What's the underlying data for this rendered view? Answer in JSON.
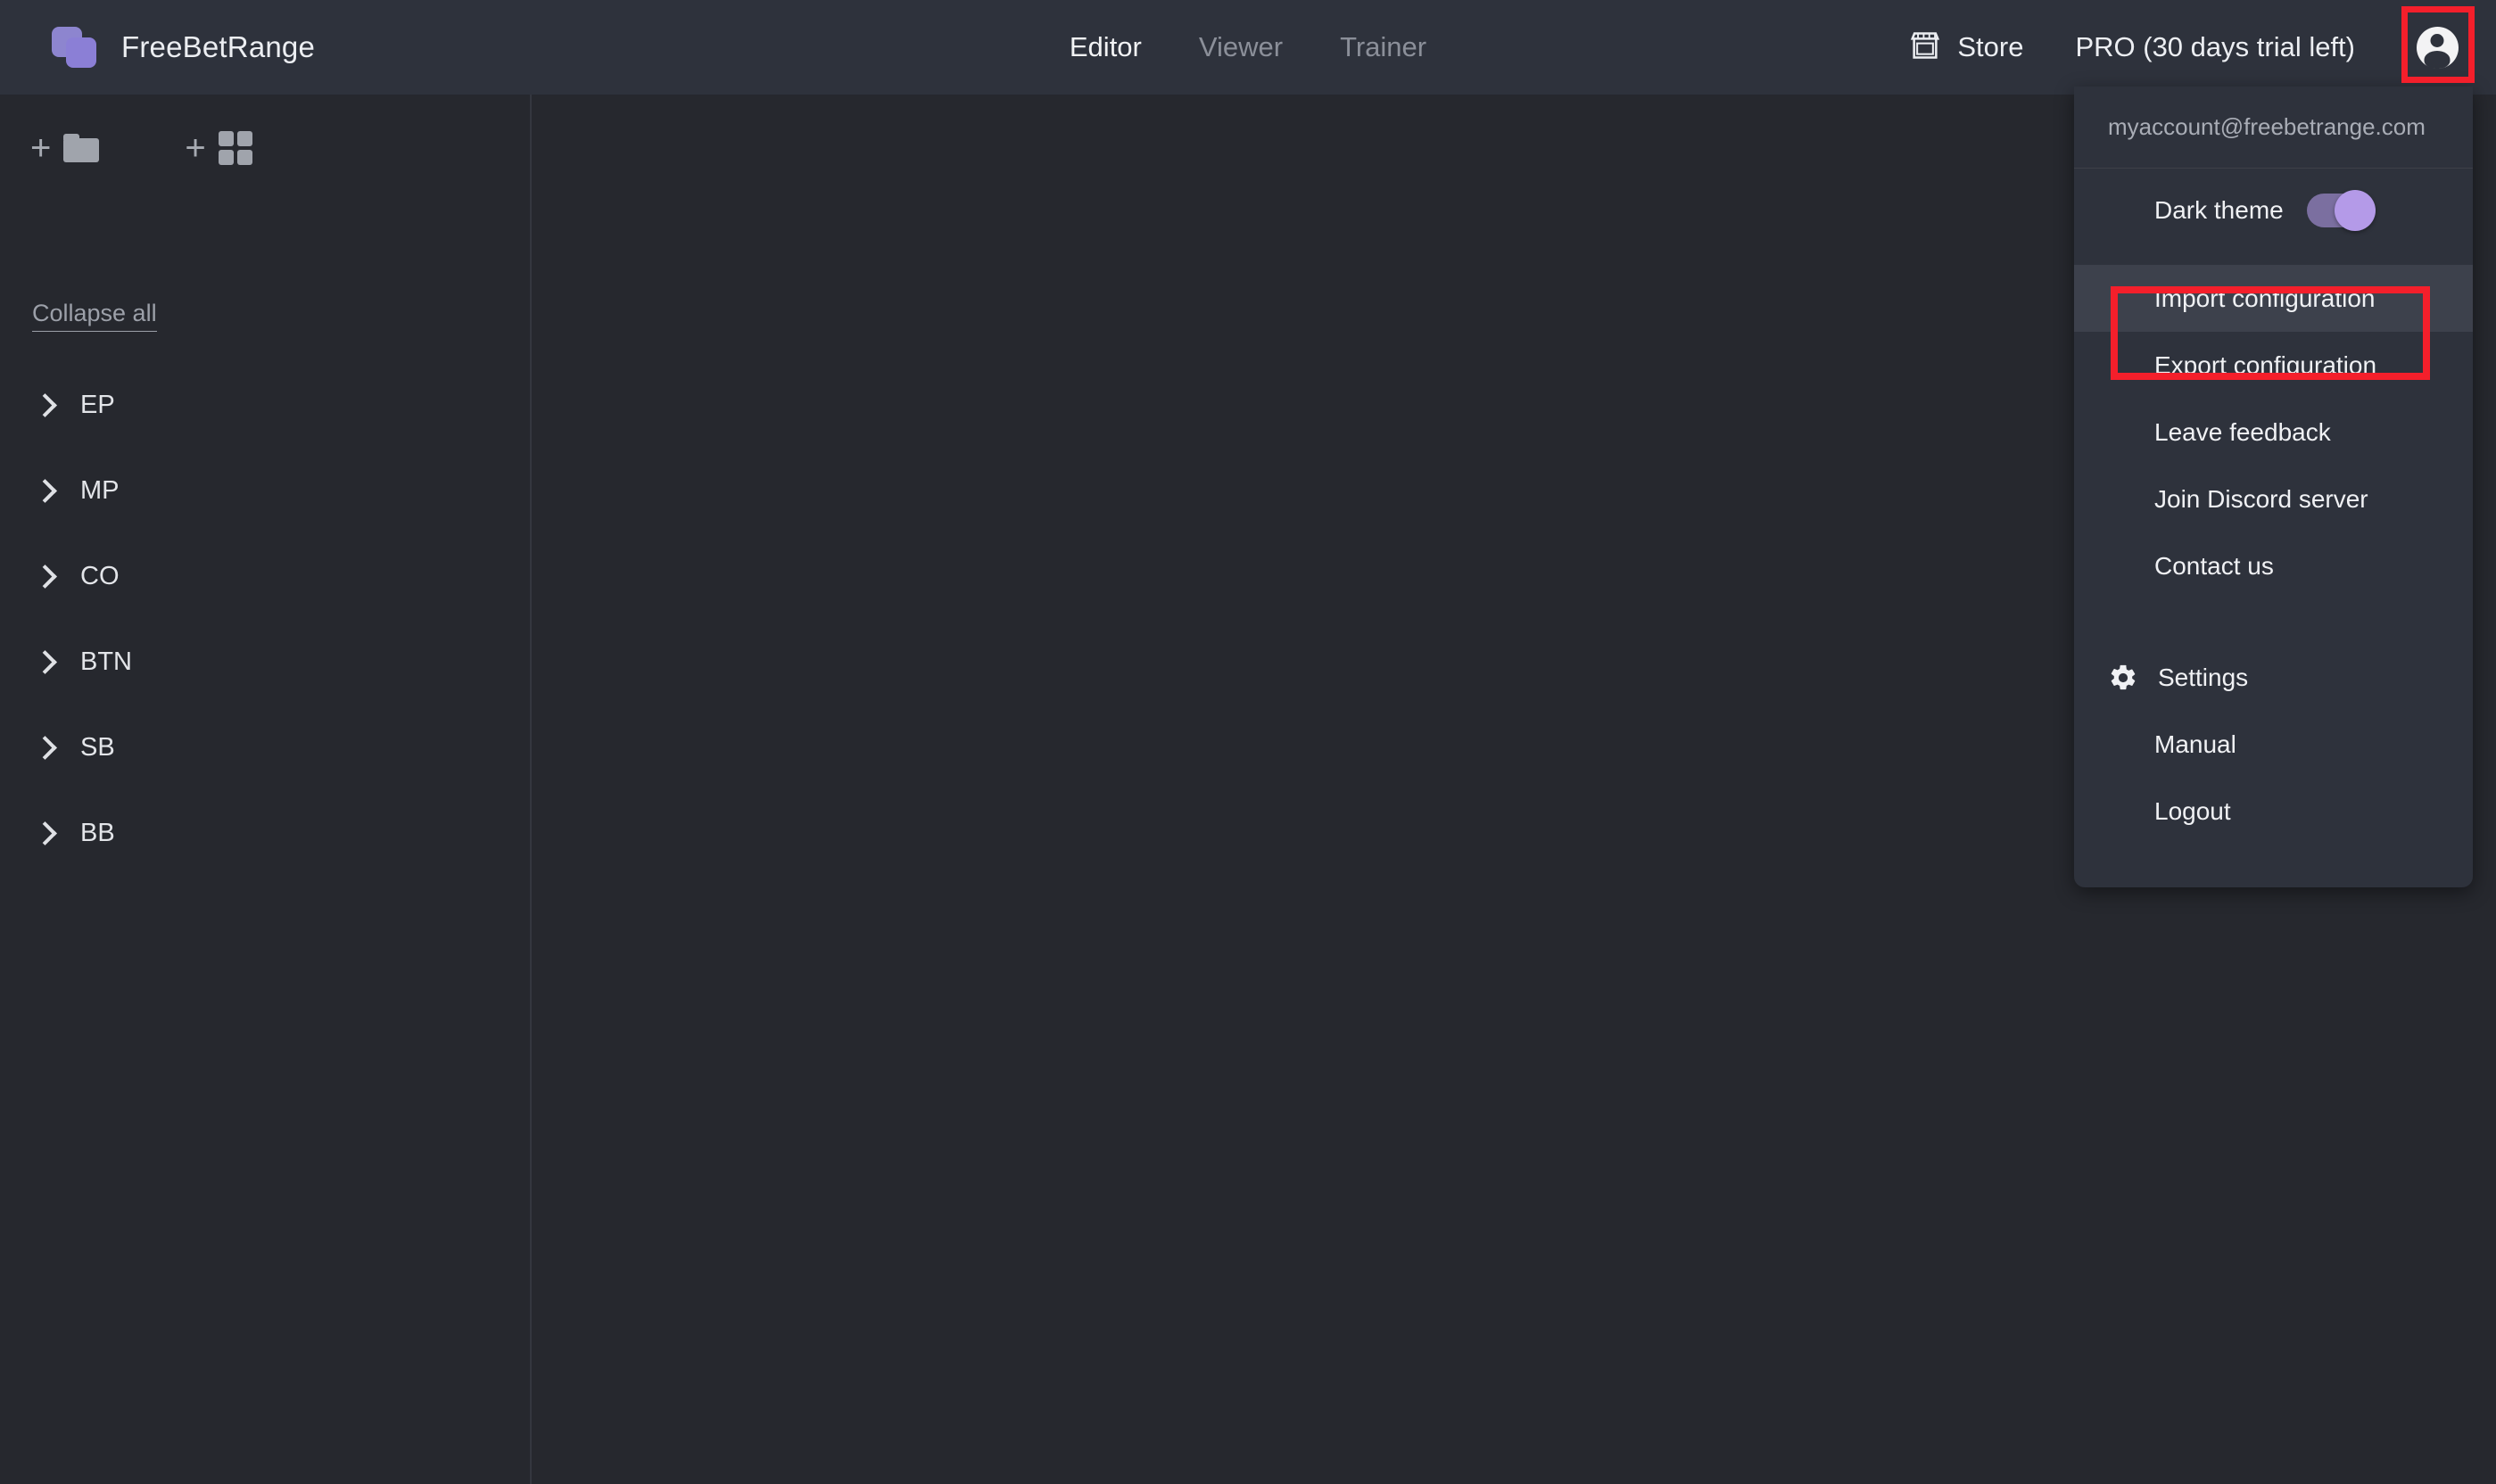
{
  "app": {
    "brand_name": "FreeBetRange",
    "logo_icon": "two-overlapping-squares-logo",
    "accent_color": "#8b7fd6",
    "highlight_color": "#f41f2b"
  },
  "header": {
    "tabs": [
      {
        "label": "Editor",
        "active": true
      },
      {
        "label": "Viewer",
        "active": false
      },
      {
        "label": "Trainer",
        "active": false
      }
    ],
    "store": {
      "label": "Store",
      "icon": "storefront-icon"
    },
    "plan_label": "PRO (30 days trial left)",
    "account_icon": "account-circle-icon"
  },
  "sidebar": {
    "actions": [
      {
        "label": "+",
        "icon": "add-folder-icon"
      },
      {
        "label": "+",
        "icon": "add-grid-icon"
      }
    ],
    "collapse_all_label": "Collapse all",
    "tree_items": [
      {
        "label": "EP",
        "icon": "chevron-right-icon"
      },
      {
        "label": "MP",
        "icon": "chevron-right-icon"
      },
      {
        "label": "CO",
        "icon": "chevron-right-icon"
      },
      {
        "label": "BTN",
        "icon": "chevron-right-icon"
      },
      {
        "label": "SB",
        "icon": "chevron-right-icon"
      },
      {
        "label": "BB",
        "icon": "chevron-right-icon"
      }
    ]
  },
  "account_menu": {
    "email": "myaccount@freebetrange.com",
    "theme": {
      "label": "Dark theme",
      "enabled": true,
      "track_color": "#7b6fa0",
      "knob_color": "#b49ae8"
    },
    "items": [
      {
        "label": "Import configuration",
        "hovered": true,
        "highlighted": true
      },
      {
        "label": "Export configuration",
        "hovered": false,
        "highlighted": false
      },
      {
        "label": "Leave feedback",
        "hovered": false,
        "highlighted": false
      },
      {
        "label": "Join Discord server",
        "hovered": false,
        "highlighted": false
      },
      {
        "label": "Contact us",
        "hovered": false,
        "highlighted": false
      }
    ],
    "footer_items": [
      {
        "label": "Settings",
        "icon": "gear-icon"
      },
      {
        "label": "Manual",
        "icon": null
      },
      {
        "label": "Logout",
        "icon": null
      }
    ]
  }
}
